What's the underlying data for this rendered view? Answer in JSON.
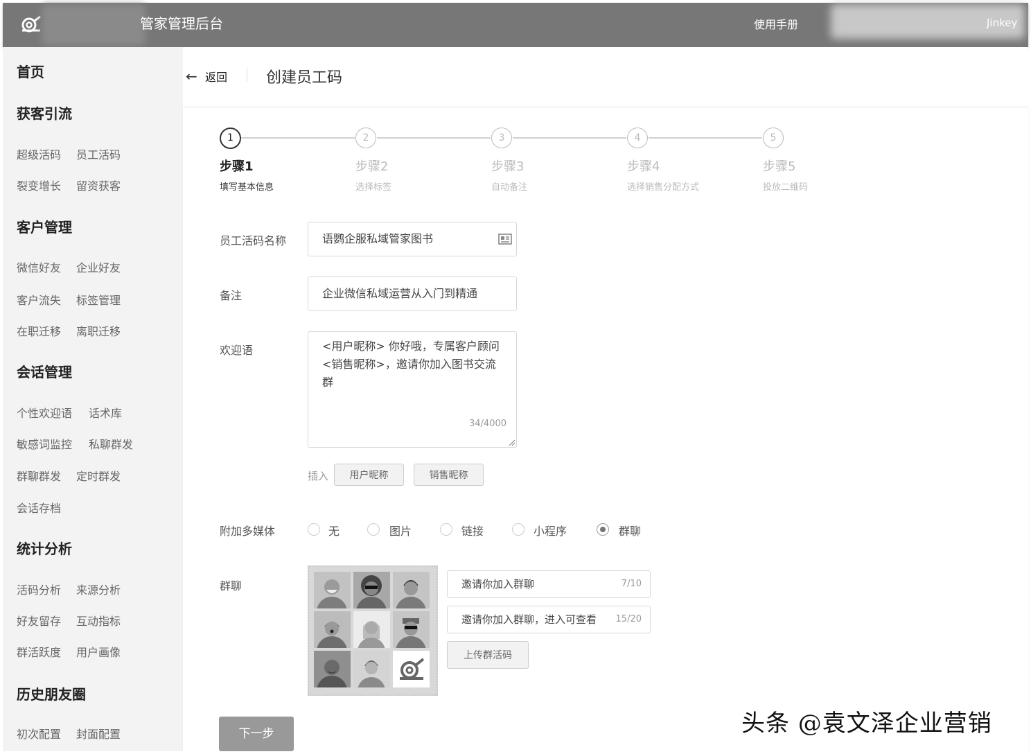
{
  "header": {
    "app_title": "管家管理后台",
    "manual": "使用手册",
    "username": "Jinkey"
  },
  "sidebar": {
    "home": "首页",
    "groups": [
      {
        "title": "获客引流",
        "links": [
          "超级活码",
          "员工活码",
          "裂变增长",
          "留资获客"
        ]
      },
      {
        "title": "客户管理",
        "links": [
          "微信好友",
          "企业好友",
          "客户流失",
          "标签管理",
          "在职迁移",
          "离职迁移"
        ]
      },
      {
        "title": "会话管理",
        "links": [
          "个性欢迎语",
          "话术库",
          "敏感词监控",
          "私聊群发",
          "群聊群发",
          "定时群发",
          "会话存档"
        ]
      },
      {
        "title": "统计分析",
        "links": [
          "活码分析",
          "来源分析",
          "好友留存",
          "互动指标",
          "群活跃度",
          "用户画像"
        ]
      },
      {
        "title": "历史朋友圈",
        "links": [
          "初次配置",
          "封面配置"
        ]
      }
    ]
  },
  "page": {
    "back": "返回",
    "title": "创建员工码"
  },
  "steps": [
    {
      "num": "1",
      "title": "步骤1",
      "desc": "填写基本信息"
    },
    {
      "num": "2",
      "title": "步骤2",
      "desc": "选择标签"
    },
    {
      "num": "3",
      "title": "步骤3",
      "desc": "自动备注"
    },
    {
      "num": "4",
      "title": "步骤4",
      "desc": "选择销售分配方式"
    },
    {
      "num": "5",
      "title": "步骤5",
      "desc": "投放二维码"
    }
  ],
  "form": {
    "name_label": "员工活码名称",
    "name_value": "语鹦企服私域管家图书",
    "note_label": "备注",
    "note_value": "企业微信私域运营从入门到精通",
    "welcome_label": "欢迎语",
    "welcome_value": "<用户昵称> 你好哦，专属客户顾问<销售昵称>，邀请你加入图书交流群",
    "welcome_count": "34/4000",
    "insert_label": "插入",
    "insert_user": "用户昵称",
    "insert_sales": "销售昵称",
    "media_label": "附加多媒体",
    "media_options": [
      "无",
      "图片",
      "链接",
      "小程序",
      "群聊"
    ],
    "media_selected": "群聊",
    "group_label": "群聊",
    "group_title": "邀请你加入群聊",
    "group_title_count": "7/10",
    "group_desc": "邀请你加入群聊，进入可查看",
    "group_desc_count": "15/20",
    "upload_btn": "上传群活码",
    "next_btn": "下一步"
  },
  "watermark": "头条 @袁文泽企业营销"
}
